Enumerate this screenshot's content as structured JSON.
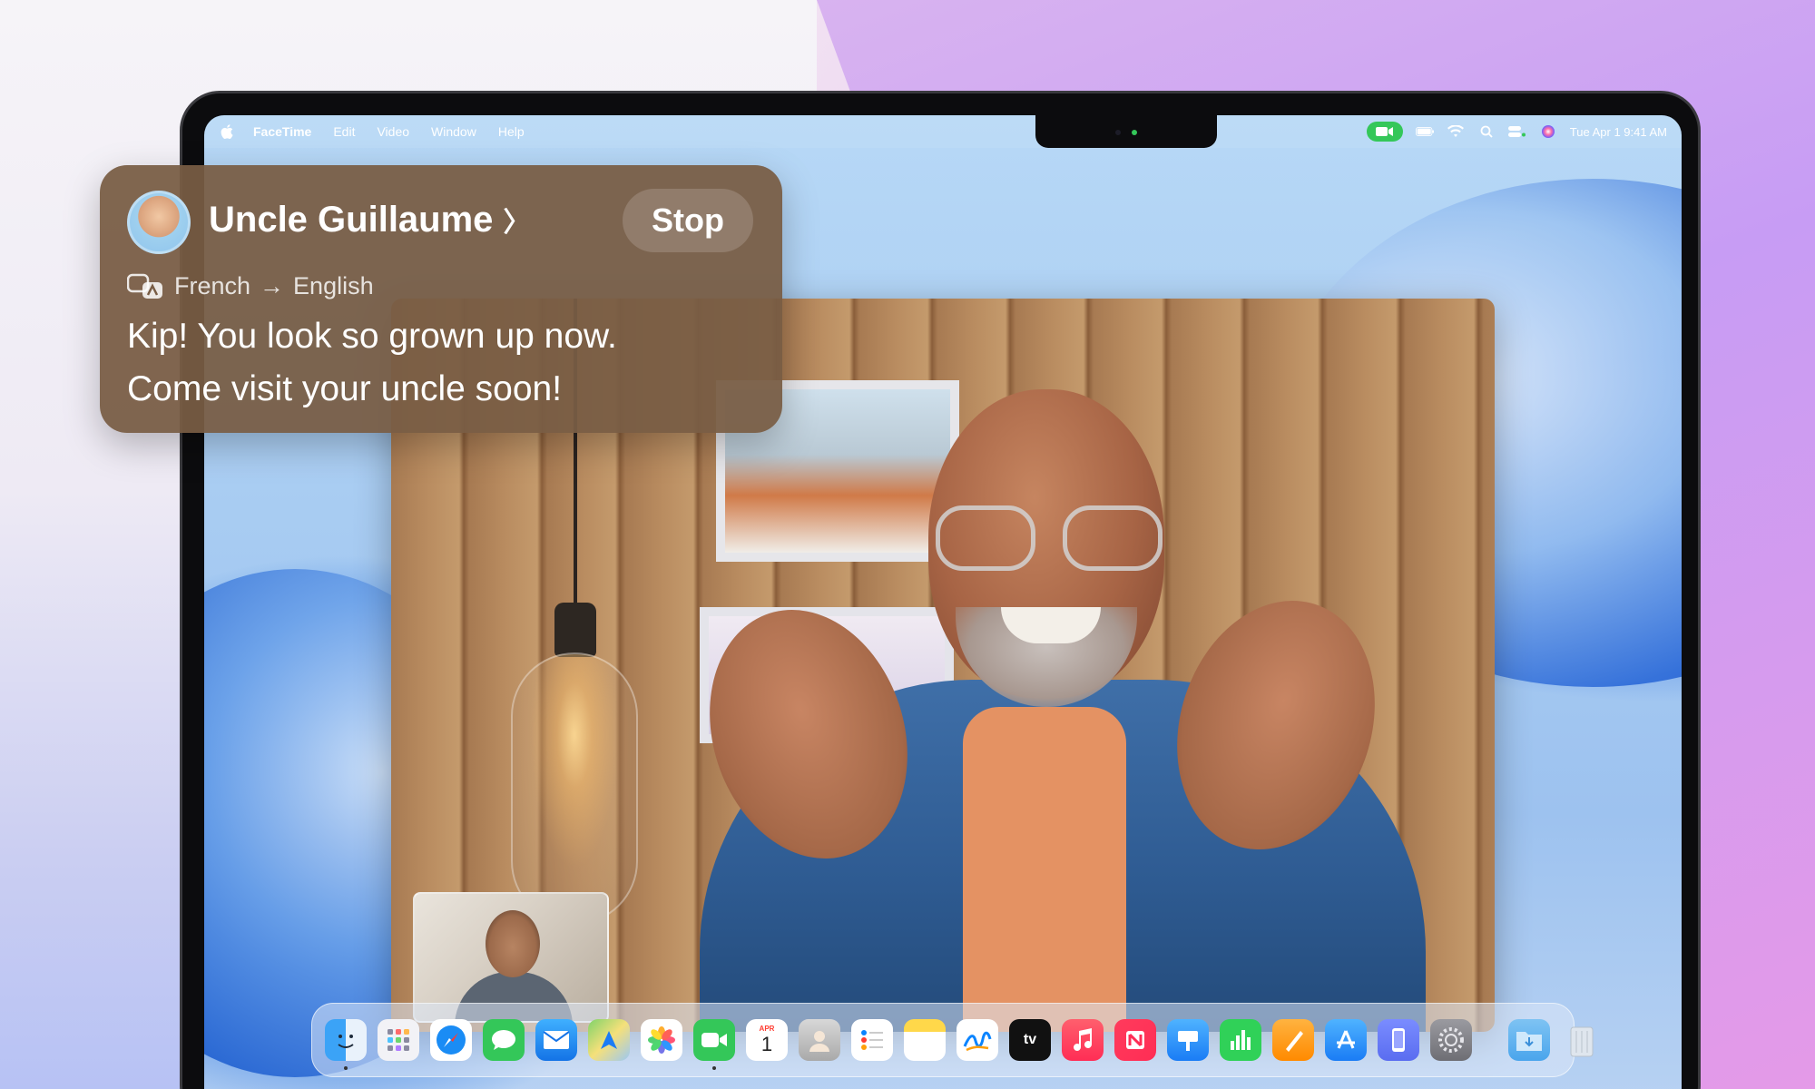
{
  "menubar": {
    "app": "FaceTime",
    "items": [
      "Edit",
      "Video",
      "Window",
      "Help"
    ],
    "datetime": "Tue Apr 1  9:41 AM"
  },
  "banner": {
    "caller": "Uncle Guillaume",
    "chevron": "〉",
    "stop_label": "Stop",
    "source_lang": "French",
    "arrow": "→",
    "target_lang": "English",
    "caption_line1": "Kip! You look so grown up now.",
    "caption_line2": "Come visit your uncle soon!"
  },
  "dock": {
    "calendar_month": "APR",
    "calendar_day": "1",
    "tv_label": "tv"
  },
  "colors": {
    "banner_bg": "#785c44",
    "facetime_green": "#34c759"
  },
  "icons": [
    "apple-logo-icon",
    "facetime-status-icon",
    "battery-icon",
    "wifi-icon",
    "spotlight-icon",
    "control-center-icon",
    "siri-icon",
    "translate-icon"
  ]
}
